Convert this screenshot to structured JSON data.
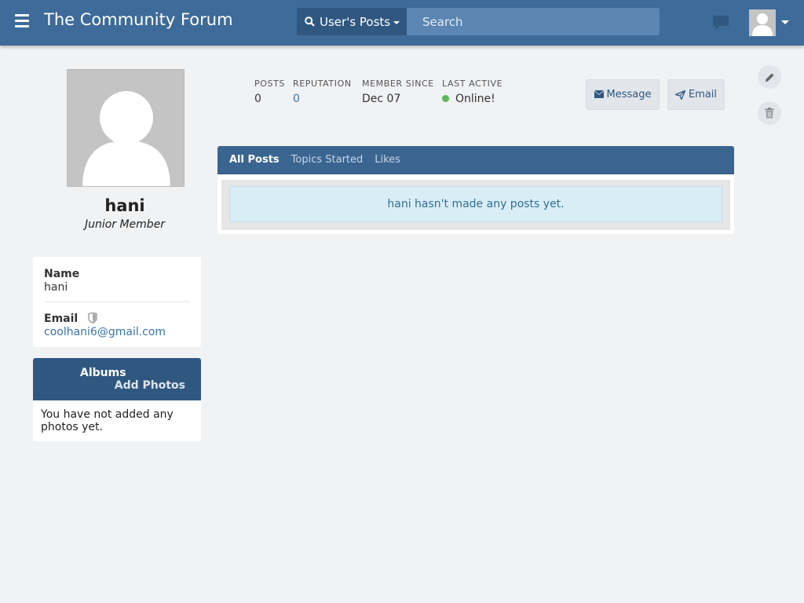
{
  "header": {
    "site_title": "The Community Forum",
    "search_scope": "User's Posts",
    "search_placeholder": "Search"
  },
  "profile": {
    "username": "hani",
    "rank": "Junior Member",
    "stats": [
      {
        "label": "Posts",
        "value": "0"
      },
      {
        "label": "Reputation",
        "value": "0"
      },
      {
        "label": "Member Since",
        "value": "Dec 07"
      },
      {
        "label": "Last Active",
        "value": "Online!"
      }
    ],
    "message_button": "Message",
    "email_button": "Email"
  },
  "info": {
    "name_label": "Name",
    "name_value": "hani",
    "email_label": "Email",
    "email_value": "coolhani6@gmail.com"
  },
  "albums": {
    "title": "Albums",
    "add_label": "Add Photos",
    "empty_text": "You have not added any photos yet."
  },
  "tabs": [
    {
      "label": "All Posts",
      "active": true
    },
    {
      "label": "Topics Started",
      "active": false
    },
    {
      "label": "Likes",
      "active": false
    }
  ],
  "posts_empty_message": "hani hasn't made any posts yet.",
  "colors": {
    "header": "#3e6b99",
    "accent": "#2f5780",
    "online": "#5cb85c",
    "link": "#3b73a8"
  },
  "icons": [
    "menu-icon",
    "search-icon",
    "chat-icon",
    "user-avatar",
    "shield-icon",
    "envelope-icon",
    "send-icon",
    "pencil-icon",
    "trash-icon"
  ]
}
